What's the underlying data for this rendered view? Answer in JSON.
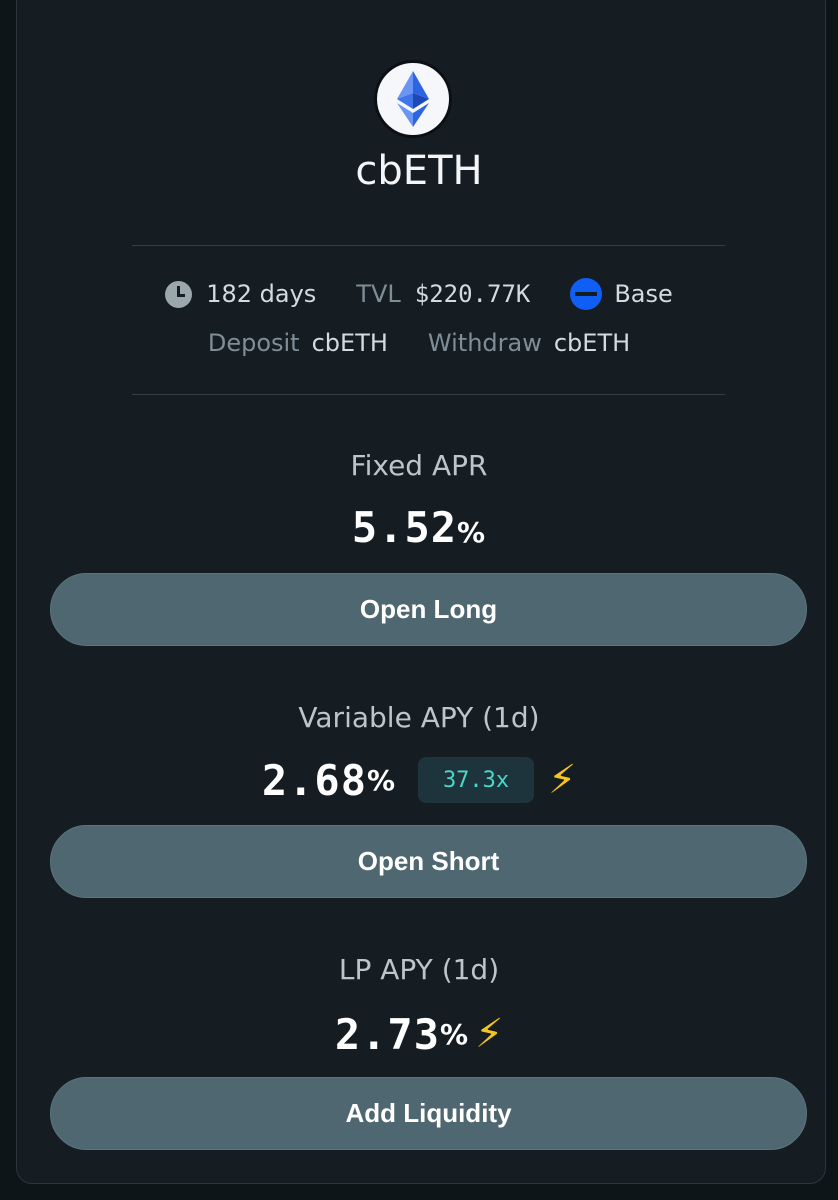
{
  "token": {
    "name": "cbETH",
    "icon": "ethereum-icon"
  },
  "meta": {
    "duration": "182 days",
    "tvl_label": "TVL",
    "tvl_value": "$220.77K",
    "chain": "Base",
    "deposit_label": "Deposit",
    "deposit_token": "cbETH",
    "withdraw_label": "Withdraw",
    "withdraw_token": "cbETH"
  },
  "fixed": {
    "label": "Fixed APR",
    "value": "5.52",
    "unit": "%",
    "button": "Open Long"
  },
  "variable": {
    "label": "Variable APY (1d)",
    "value": "2.68",
    "unit": "%",
    "multiplier": "37.3x",
    "button": "Open Short"
  },
  "lp": {
    "label": "LP APY (1d)",
    "value": "2.73",
    "unit": "%",
    "button": "Add Liquidity"
  },
  "colors": {
    "background": "#151d23",
    "button": "#4f6771",
    "accent_teal": "#4ad7c8",
    "bolt_yellow": "#f6c51b",
    "base_blue": "#0f5ef6"
  }
}
